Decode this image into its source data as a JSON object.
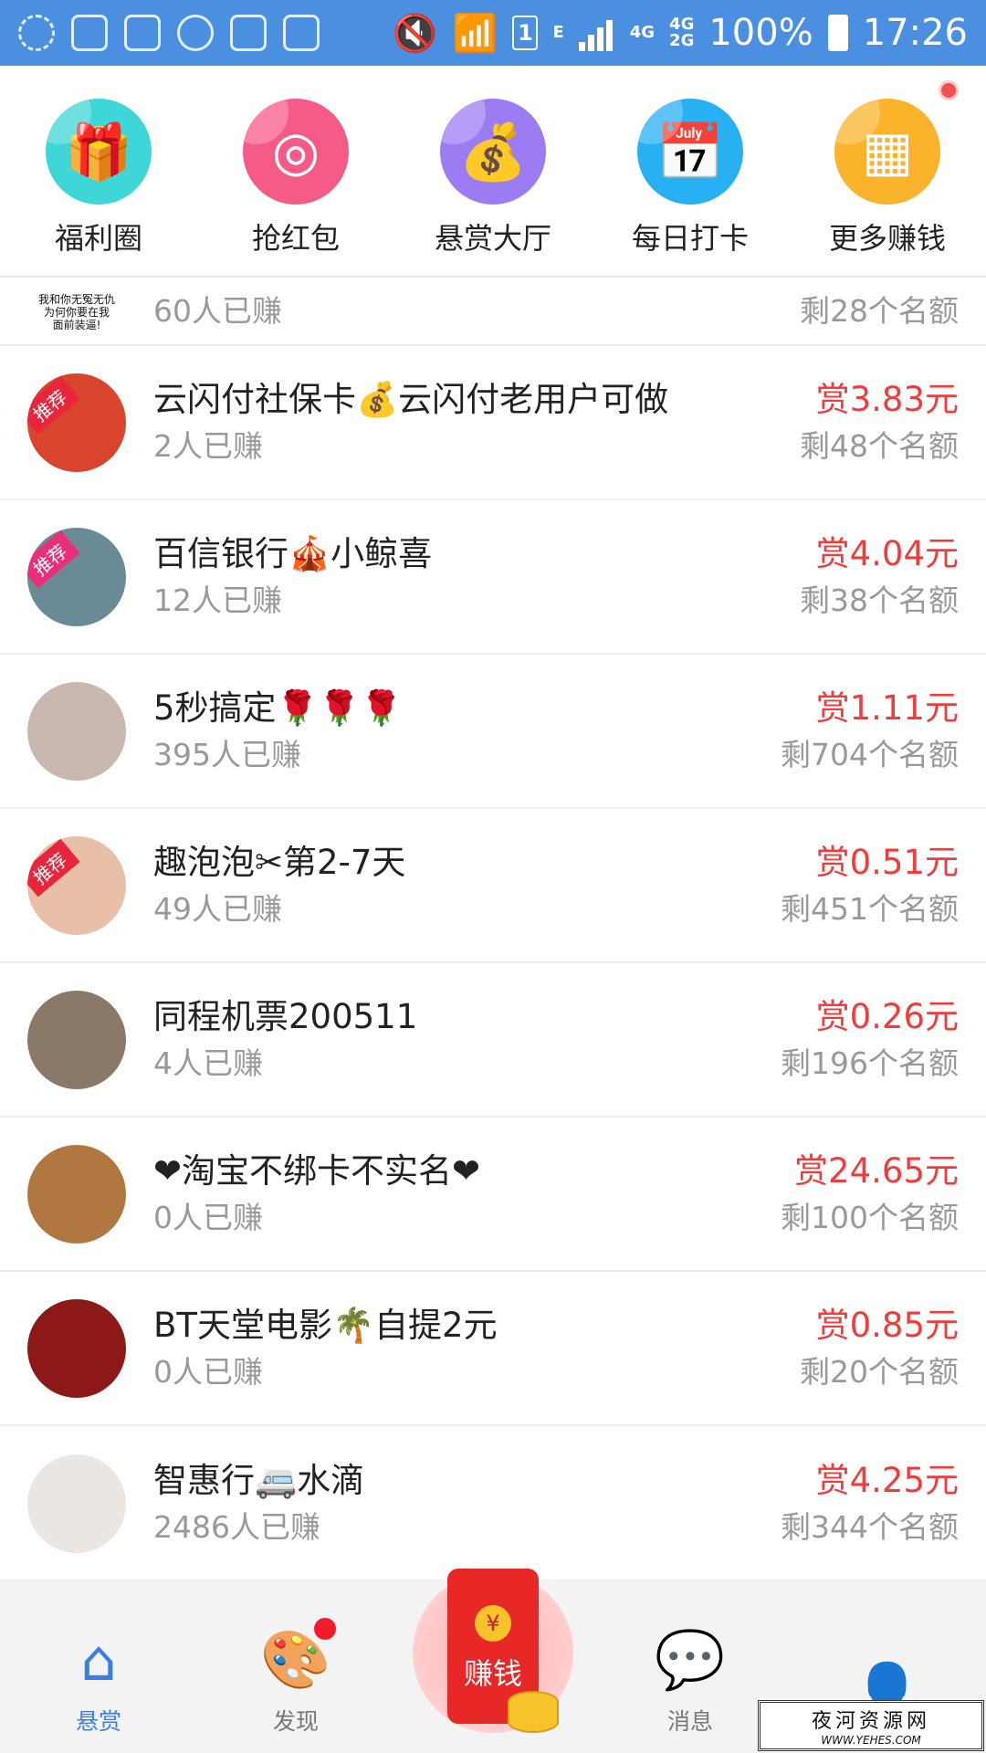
{
  "statusbar": {
    "net_e": "E",
    "net_4g": "4G",
    "net_4g2": "4G",
    "net_2g": "2G",
    "sim": "1",
    "battery": "100%",
    "time": "17:26"
  },
  "quickmenu": [
    {
      "label": "福利圈",
      "icon": "gift-icon",
      "color": "#3fd6d8"
    },
    {
      "label": "抢红包",
      "icon": "red-packet-icon",
      "color": "#f65a86"
    },
    {
      "label": "悬赏大厅",
      "icon": "money-bag-icon",
      "color": "#9b7cf2"
    },
    {
      "label": "每日打卡",
      "icon": "calendar-check-icon",
      "color": "#27b0f2"
    },
    {
      "label": "更多赚钱",
      "icon": "grid-apps-icon",
      "color": "#fbb32b"
    }
  ],
  "partial_row": {
    "avatar_text": [
      "我和你无冤无仇",
      "为何你要在我",
      "面前装逼!"
    ],
    "earned": "60人已赚",
    "remain": "剩28个名额"
  },
  "tasks": [
    {
      "title": "云闪付社保卡💰云闪付老用户可做",
      "earned": "2人已赚",
      "reward": "赏3.83元",
      "remain": "剩48个名额",
      "tag": "推荐",
      "avatar_color": "#d9452c"
    },
    {
      "title": "百信银行🎪小鲸喜",
      "earned": "12人已赚",
      "reward": "赏4.04元",
      "remain": "剩38个名额",
      "tag": "推荐",
      "avatar_color": "#6a8a96"
    },
    {
      "title": "5秒搞定🌹🌹🌹",
      "earned": "395人已赚",
      "reward": "赏1.11元",
      "remain": "剩704个名额",
      "tag": "",
      "avatar_color": "#c9b8b0"
    },
    {
      "title": "趣泡泡✂第2-7天",
      "earned": "49人已赚",
      "reward": "赏0.51元",
      "remain": "剩451个名额",
      "tag": "推荐",
      "avatar_color": "#e8c0a8"
    },
    {
      "title": "同程机票200511",
      "earned": "4人已赚",
      "reward": "赏0.26元",
      "remain": "剩196个名额",
      "tag": "",
      "avatar_color": "#8a7868"
    },
    {
      "title": "❤淘宝不绑卡不实名❤",
      "earned": "0人已赚",
      "reward": "赏24.65元",
      "remain": "剩100个名额",
      "tag": "",
      "avatar_color": "#b07840"
    },
    {
      "title": "BT天堂电影🌴自提2元",
      "earned": "0人已赚",
      "reward": "赏0.85元",
      "remain": "剩20个名额",
      "tag": "",
      "avatar_color": "#8c1818"
    },
    {
      "title": "智惠行🚐水滴",
      "earned": "2486人已赚",
      "reward": "赏4.25元",
      "remain": "剩344个名额",
      "tag": "",
      "avatar_color": "#ece6e2"
    }
  ],
  "bottomnav": {
    "home": "悬赏",
    "discover": "发现",
    "earn": "赚钱",
    "earn_coin": "¥",
    "messages": "消息",
    "profile": ""
  },
  "watermark": {
    "line1": "夜河资源网",
    "line2": "WWW.YEHES.COM"
  }
}
